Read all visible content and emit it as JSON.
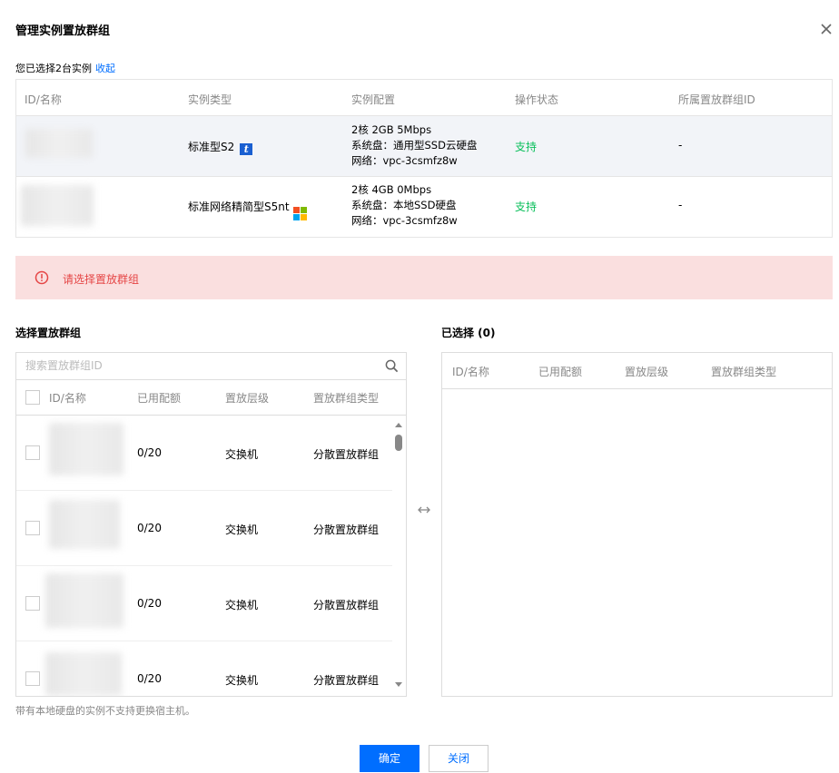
{
  "dialog": {
    "title": "管理实例置放群组",
    "close_icon": "close-icon"
  },
  "selection": {
    "text": "您已选择2台实例",
    "collapse_link": "收起"
  },
  "instance_table": {
    "columns": [
      "ID/名称",
      "实例类型",
      "实例配置",
      "操作状态",
      "所属置放群组ID"
    ],
    "rows": [
      {
        "id_name": "",
        "type": "标准型S2",
        "os_icon": "tencent-os-icon",
        "config": [
          "2核 2GB 5Mbps",
          "系统盘：通用型SSD云硬盘",
          "网络：vpc-3csmfz8w"
        ],
        "status": "支持",
        "group_id": "-"
      },
      {
        "id_name": "",
        "type": "标准网络精简型S5nt",
        "os_icon": "windows-icon",
        "config": [
          "2核 4GB 0Mbps",
          "系统盘：本地SSD硬盘",
          "网络：vpc-3csmfz8w"
        ],
        "status": "支持",
        "group_id": "-"
      }
    ]
  },
  "alert": {
    "icon": "warning-circle-icon",
    "text": "请选择置放群组",
    "color": "#e54545",
    "background": "#fadfdf"
  },
  "left_panel": {
    "title": "选择置放群组",
    "search_placeholder": "搜索置放群组ID",
    "columns": [
      "ID/名称",
      "已用配额",
      "置放层级",
      "置放群组类型"
    ],
    "rows": [
      {
        "id_name": "",
        "quota": "0/20",
        "level": "交换机",
        "group_type": "分散置放群组"
      },
      {
        "id_name": "",
        "quota": "0/20",
        "level": "交换机",
        "group_type": "分散置放群组"
      },
      {
        "id_name": "",
        "quota": "0/20",
        "level": "交换机",
        "group_type": "分散置放群组"
      },
      {
        "id_name": "",
        "quota": "0/20",
        "level": "交换机",
        "group_type": "分散置放群组"
      }
    ]
  },
  "right_panel": {
    "title": "已选择 (0)",
    "columns": [
      "ID/名称",
      "已用配额",
      "置放层级",
      "置放群组类型"
    ]
  },
  "note": "带有本地硬盘的实例不支持更换宿主机。",
  "buttons": {
    "confirm": "确定",
    "close": "关闭"
  },
  "colors": {
    "primary": "#006eff",
    "success": "#0abf5b",
    "selected_row": "#f2f4f8"
  }
}
